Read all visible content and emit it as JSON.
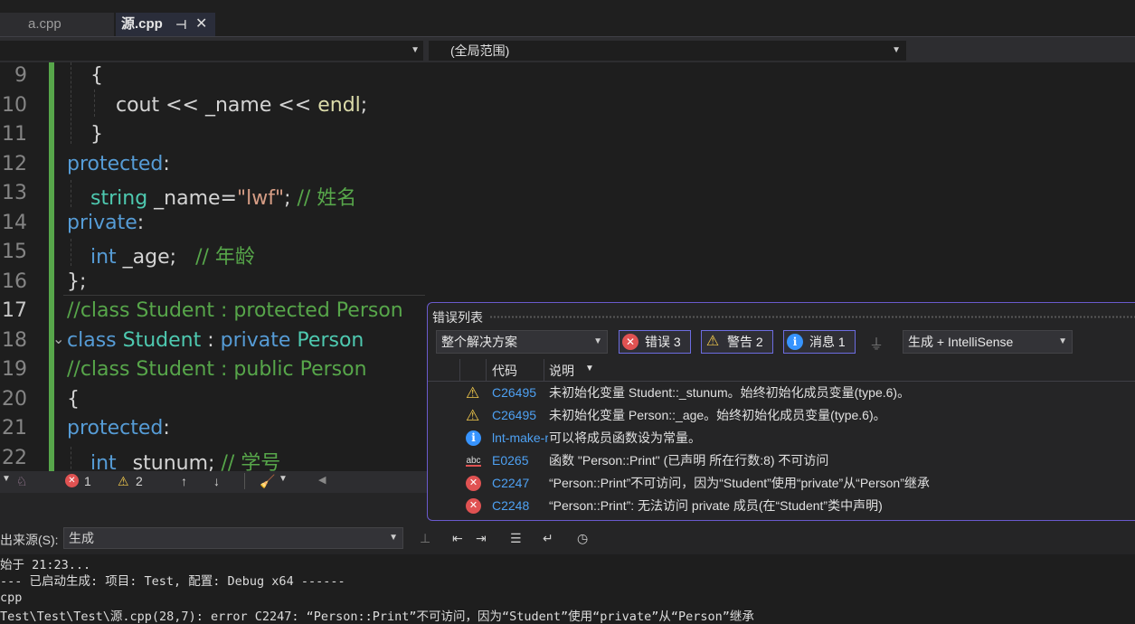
{
  "tabs": [
    {
      "label": "a.cpp"
    },
    {
      "label": "源.cpp",
      "pin_icon": "pin-icon",
      "close_icon": "✕"
    }
  ],
  "navbar": {
    "left_value": "",
    "scope": "(全局范围)"
  },
  "editor": {
    "lines": [
      {
        "num": "9"
      },
      {
        "num": "10"
      },
      {
        "num": "11"
      },
      {
        "num": "12"
      },
      {
        "num": "13"
      },
      {
        "num": "14"
      },
      {
        "num": "15"
      },
      {
        "num": "16"
      },
      {
        "num": "17"
      },
      {
        "num": "18"
      },
      {
        "num": "19"
      },
      {
        "num": "20"
      },
      {
        "num": "21"
      },
      {
        "num": "22"
      }
    ],
    "code": {
      "l9": "{",
      "l10_a": "cout",
      "l10_b": " << ",
      "l10_c": "_name",
      "l10_d": " << ",
      "l10_e": "endl",
      "l10_f": ";",
      "l11": "}",
      "l12_a": "protected",
      "l12_b": ":",
      "l13_a": "string",
      "l13_b": " _name=",
      "l13_c": "\"lwf\"",
      "l13_d": "; ",
      "l13_e": "// 姓名",
      "l14_a": "private",
      "l14_b": ":",
      "l15_a": "int",
      "l15_b": " _age;   ",
      "l15_c": "// 年龄",
      "l16": "};",
      "l17": "//class Student : protected Person",
      "l18_a": "class",
      "l18_b": " Student",
      "l18_c": " : ",
      "l18_d": "private",
      "l18_e": " Person",
      "l19": "//class Student : public Person",
      "l20": "{",
      "l21_a": "protected",
      "l21_b": ":",
      "l22_a": "int",
      "l22_b": " _stunum; ",
      "l22_c": "// 学号"
    }
  },
  "statusbar": {
    "errors": "1",
    "warnings": "2"
  },
  "error_list": {
    "title": "错误列表",
    "scope": "整个解决方案",
    "filters": {
      "errors": "错误 3",
      "warnings": "警告 2",
      "messages": "消息 1"
    },
    "build_source": "生成 + IntelliSense",
    "columns": {
      "code": "代码",
      "description": "说明"
    },
    "rows": [
      {
        "icon": "warning-icon",
        "code": "C26495",
        "description": "未初始化变量 Student::_stunum。始终初始化成员变量(type.6)。"
      },
      {
        "icon": "warning-icon",
        "code": "C26495",
        "description": "未初始化变量 Person::_age。始终初始化成员变量(type.6)。"
      },
      {
        "icon": "info-icon",
        "code": "lnt-make-member-function-const",
        "description": "可以将成员函数设为常量。"
      },
      {
        "icon": "intellisense-icon",
        "code": "E0265",
        "description": "函数 \"Person::Print\" (已声明 所在行数:8) 不可访问"
      },
      {
        "icon": "error-icon",
        "code": "C2247",
        "description": "“Person::Print”不可访问，因为“Student”使用“private”从“Person”继承"
      },
      {
        "icon": "error-icon",
        "code": "C2248",
        "description": "“Person::Print”: 无法访问 private 成员(在“Student”类中声明)"
      }
    ]
  },
  "output": {
    "source_label": "出来源(S):",
    "source_value": "生成",
    "lines": [
      "始于 21:23...",
      "--- 已启动生成: 项目: Test, 配置: Debug x64 ------",
      "cpp",
      "Test\\Test\\Test\\源.cpp(28,7): error C2247: “Person::Print”不可访问，因为“Student”使用“private”从“Person”继承"
    ]
  },
  "colors": {
    "keyword": "#569cd6",
    "type": "#4ec9b0",
    "comment": "#57a64a",
    "string": "#d69d85",
    "accent": "#6a5acd"
  }
}
